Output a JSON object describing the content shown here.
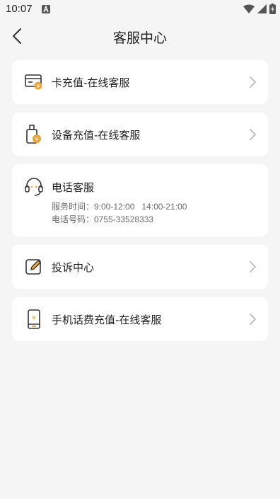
{
  "status": {
    "time": "10:07"
  },
  "header": {
    "title": "客服中心"
  },
  "items": [
    {
      "label": "卡充值-在线客服",
      "icon": "card-recharge-icon"
    },
    {
      "label": "设备充值-在线客服",
      "icon": "device-recharge-icon"
    },
    {
      "label": "电话客服",
      "icon": "headset-icon",
      "service_hours": "服务时间：9:00-12:00   14:00-21:00",
      "phone": "电话号码：0755-33528333"
    },
    {
      "label": "投诉中心",
      "icon": "complaint-edit-icon"
    },
    {
      "label": "手机话费充值-在线客服",
      "icon": "phone-bill-icon"
    }
  ],
  "colors": {
    "accent": "#f0a53a",
    "background": "#f5f5f5",
    "card": "#ffffff"
  }
}
